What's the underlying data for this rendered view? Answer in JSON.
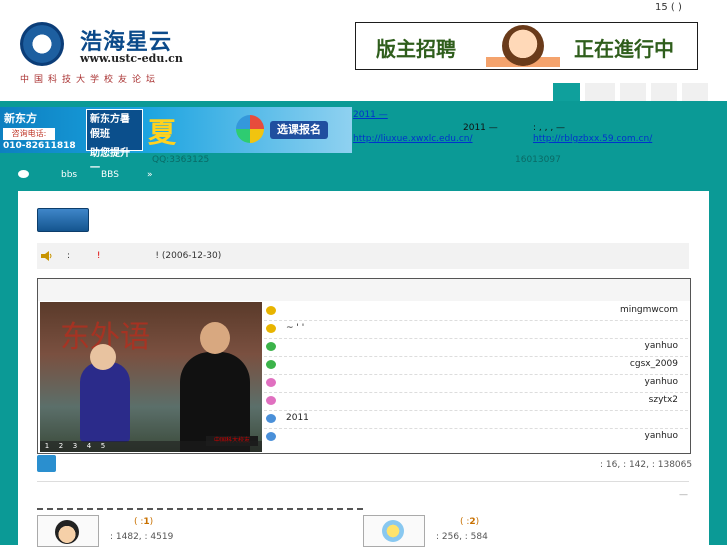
{
  "header": {
    "logo_title": "浩海星云",
    "logo_url": "www.ustc-edu.cn",
    "logo_sub": "中国科技大学校友论坛",
    "top_right": "15 ( )",
    "banner_left": "版主招聘",
    "banner_right": "正在進行中"
  },
  "ad": {
    "brand": "新东方",
    "phone_label": "咨询电话:",
    "phone": "010-82611818",
    "box_line1": "新东方暑假班",
    "box_line2": "助您提升一",
    "big_char": "夏",
    "button": "选课报名"
  },
  "announcements": {
    "item1_title": "2011 —",
    "item1_text": "2011 —",
    "item1_link": "http://liuxue.xwxlc.edu.cn/",
    "item2_text": ": , , , —",
    "item2_link": "http://rblgzbxx.59.com.cn/",
    "qq": "QQ:3363125",
    "phone": "16013097"
  },
  "nav": {
    "bbs": "bbs",
    "bbs2": "BBS",
    "arrow": "»"
  },
  "notice": {
    "prefix": ":",
    "mark": "!",
    "mark2": "!",
    "date": "(2006-12-30)"
  },
  "slideshow": {
    "calligraphy": "东外语",
    "caption": "中国科大校友",
    "nums": [
      "1",
      "2",
      "3",
      "4",
      "5"
    ]
  },
  "threads": [
    {
      "title": "",
      "author": "mingmwcom",
      "color": "#e8b400"
    },
    {
      "title": "~ ' '",
      "author": "",
      "color": "#e8b400"
    },
    {
      "title": "",
      "author": "yanhuo",
      "color": "#3cb34a"
    },
    {
      "title": "",
      "author": "cgsx_2009",
      "color": "#3cb34a"
    },
    {
      "title": "",
      "author": "yanhuo",
      "color": "#e070c0"
    },
    {
      "title": "",
      "author": "szytx2",
      "color": "#e070c0"
    },
    {
      "title": "2011",
      "author": "",
      "color": "#4a90d9"
    },
    {
      "title": "",
      "author": "yanhuo",
      "color": "#4a90d9"
    }
  ],
  "stats": ": 16, : 142, : 138065",
  "small_dash": "—",
  "forums": [
    {
      "title_prefix": "( :",
      "num": "1",
      "title_suffix": ")",
      "stats": ": 1482, : 4519"
    },
    {
      "title_prefix": "( :",
      "num": "2",
      "title_suffix": ")",
      "stats": ": 256, : 584"
    }
  ]
}
